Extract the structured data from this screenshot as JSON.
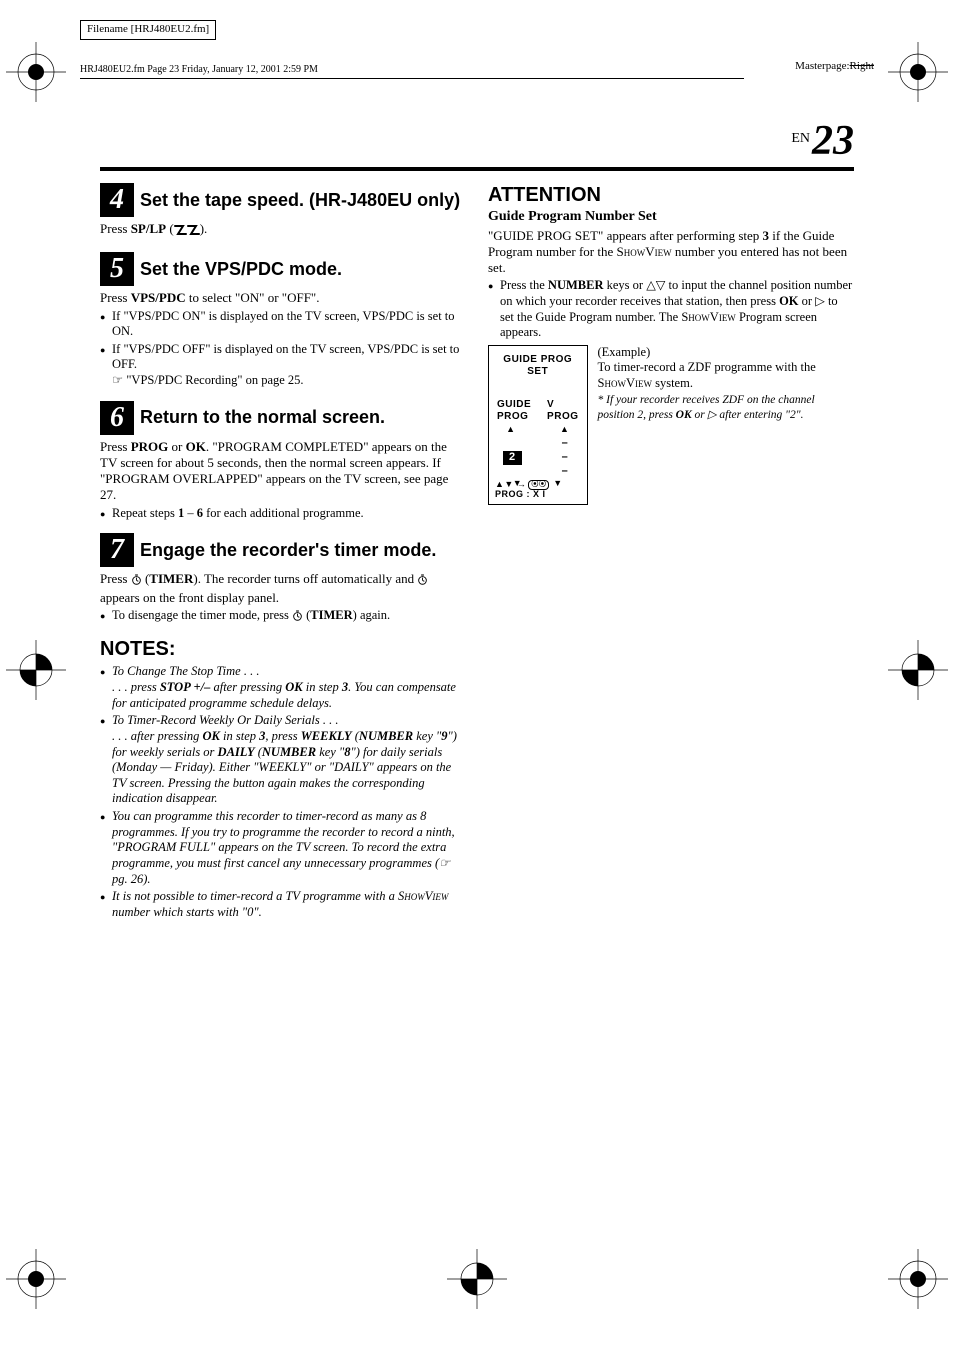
{
  "filename_box": "Filename [HRJ480EU2.fm]",
  "masterpage_label": "Masterpage:",
  "masterpage_value": "Right",
  "header_line": "HRJ480EU2.fm  Page 23  Friday, January 12, 2001  2:59 PM",
  "page_label": "EN",
  "page_number": "23",
  "left": {
    "step4": {
      "num": "4",
      "title": "Set the tape speed. (HR-J480EU only)",
      "p": "Press SP/LP ( ).",
      "p_pre": "Press ",
      "p_key": "SP/LP",
      "p_post": " ("
    },
    "step5": {
      "num": "5",
      "title": "Set the VPS/PDC mode.",
      "p1_pre": "Press ",
      "p1_key": "VPS/PDC",
      "p1_post": " to select \"ON\" or \"OFF\".",
      "b1": "If \"VPS/PDC  ON\" is displayed on the TV screen, VPS/PDC is set to ON.",
      "b2": "If \"VPS/PDC OFF\" is displayed on the TV screen, VPS/PDC is set to OFF.",
      "b2_ref": "☞ \"VPS/PDC Recording\" on page 25."
    },
    "step6": {
      "num": "6",
      "title": "Return to the normal screen.",
      "p_pre": "Press ",
      "p_k1": "PROG",
      "p_mid1": " or ",
      "p_k2": "OK",
      "p_post1": ". \"PROGRAM COMPLETED\" appears on the TV screen for about 5 seconds, then the normal screen appears. If \"PROGRAM OVERLAPPED\" appears on the TV screen, see page 27.",
      "b1_pre": "Repeat steps ",
      "b1_k1": "1",
      "b1_mid": " – ",
      "b1_k2": "6",
      "b1_post": " for each additional programme."
    },
    "step7": {
      "num": "7",
      "title": "Engage the recorder's timer mode.",
      "p1a": "Press ",
      "p1b": " (",
      "p1_timer": "TIMER",
      "p1c": "). The recorder turns off automatically and ",
      "p1d": " appears on the front display panel.",
      "b1a": "To disengage the timer mode, press ",
      "b1b": " (",
      "b1_timer": "TIMER",
      "b1c": ") again."
    },
    "notes_head": "NOTES:",
    "notes": {
      "n1_head": "To Change The Stop Time . . .",
      "n1_body_a": ". . . press ",
      "n1_body_key": "STOP +/–",
      "n1_body_b": " after pressing ",
      "n1_body_key2": "OK",
      "n1_body_c": " in step ",
      "n1_body_step": "3",
      "n1_body_d": ". You can compensate for anticipated programme schedule delays.",
      "n2_head": "To Timer-Record Weekly Or Daily Serials . . .",
      "n2_a": ". . . after pressing ",
      "n2_k1": "OK",
      "n2_b": " in step ",
      "n2_step": "3",
      "n2_c": ", press ",
      "n2_k2": "WEEKLY",
      "n2_d": " (",
      "n2_k3": "NUMBER",
      "n2_e": " key \"",
      "n2_k4": "9",
      "n2_f": "\") for weekly serials or ",
      "n2_k5": "DAILY",
      "n2_g": " (",
      "n2_k6": "NUMBER",
      "n2_h": " key \"",
      "n2_k7": "8",
      "n2_i": "\") for daily serials (Monday — Friday). Either \"WEEKLY\" or \"DAILY\" appears on the TV screen. Pressing the button again makes the corresponding indication disappear.",
      "n3": "You can programme this recorder to timer-record as many as 8 programmes. If you try to programme the recorder to record a ninth, \"PROGRAM FULL\" appears on the TV screen. To record the extra programme, you must first cancel any unnecessary programmes (☞ pg. 26).",
      "n4_a": "It is not possible to timer-record a TV programme with a ",
      "n4_sv": "ShowView",
      "n4_b": " number which starts with \"0\"."
    }
  },
  "right": {
    "attn_head": "ATTENTION",
    "attn_sub": "Guide Program Number Set",
    "p1_a": "\"GUIDE PROG SET\" appears after performing step ",
    "p1_step": "3",
    "p1_b": " if the Guide Program number for the ",
    "p1_sv": "ShowView",
    "p1_c": " number you entered has not been set.",
    "b1_a": "Press the ",
    "b1_k1": "NUMBER",
    "b1_b": " keys or ",
    "b1_tri": "△▽",
    "b1_c": " to input the channel position number on which your recorder receives that station, then press ",
    "b1_k2": "OK",
    "b1_d": " or ",
    "b1_tri2": "▷",
    "b1_e": " to set the Guide Program number. The ",
    "b1_sv": "ShowView",
    "b1_f": " Program screen appears.",
    "osd": {
      "title": "GUIDE PROG SET",
      "c1": "GUIDE PROG",
      "c2": "V PROG",
      "val": "2",
      "dashes": "– – –",
      "foot1": "▲▼ → ",
      "foot2": "PROG :   X I"
    },
    "example_label": "(Example)",
    "example_a": "To timer-record a ZDF programme with the ",
    "example_sv": "ShowView",
    "example_b": " system.",
    "example_note_a": "* If your recorder receives ZDF on the channel position 2, press ",
    "example_note_k": "OK",
    "example_note_b": " or ",
    "example_note_tri": "▷",
    "example_note_c": " after entering \"2\"."
  }
}
